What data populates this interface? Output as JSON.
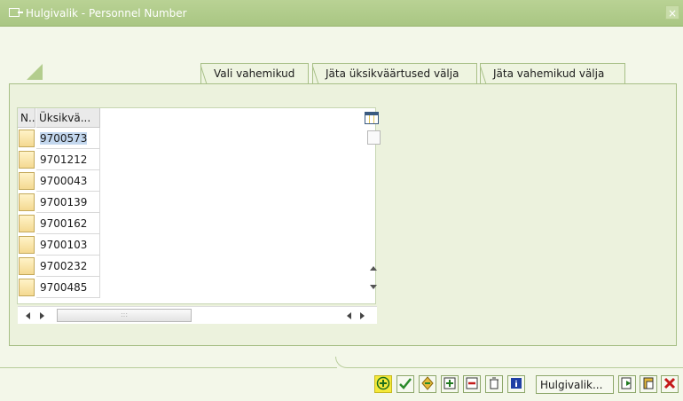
{
  "window": {
    "title": "Hulgivalik - Personnel Number",
    "close_symbol": "×"
  },
  "tabs": [
    {
      "label": "Vali vahemikud"
    },
    {
      "label": "Jäta üksikväärtused välja"
    },
    {
      "label": "Jäta vahemikud välja"
    }
  ],
  "table": {
    "col_n": "N..",
    "col_value": "Üksikvä...",
    "rows": [
      "9700573",
      "9701212",
      "9700043",
      "9700139",
      "9700162",
      "9700103",
      "9700232",
      "9700485"
    ],
    "hscroll_grip": ":::"
  },
  "toolbar": {
    "multi_label": "Hulgivalik...",
    "icons": [
      "execute-icon",
      "check-icon",
      "transfer-icon",
      "insert-line-icon",
      "delete-line-icon",
      "trash-icon",
      "info-icon",
      "import-icon",
      "paste-icon",
      "cancel-icon"
    ],
    "execute_highlight_color": "#f5e93a",
    "cancel_color": "#c41a1a"
  },
  "colors": {
    "titlebar": "#a9c683",
    "background": "#f3f7e9",
    "selection": "#c3d7ee"
  }
}
